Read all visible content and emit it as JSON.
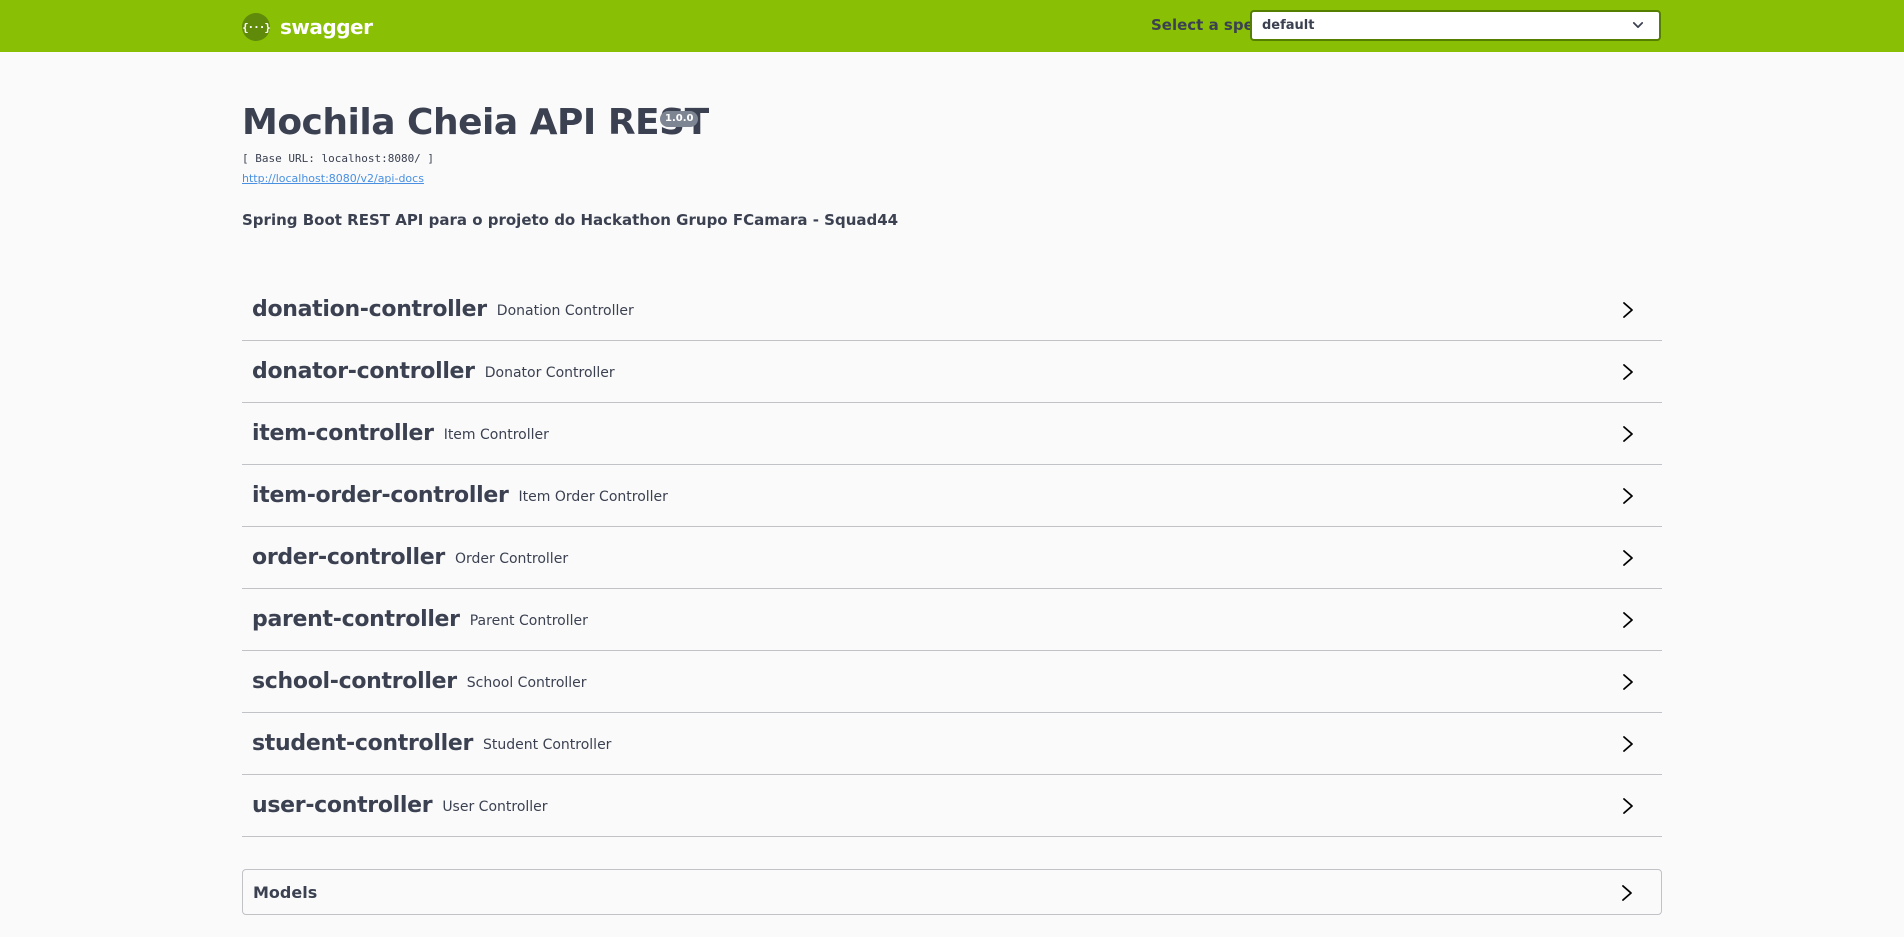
{
  "topbar": {
    "logo_glyph": "{···}",
    "logo_text": "swagger",
    "spec_label": "Select a spec",
    "spec_selected": "default",
    "logo_color": "#89bf04",
    "select_border_color": "#547f00"
  },
  "info": {
    "title": "Mochila Cheia API REST",
    "version": "1.0.0",
    "base_url": "[ Base URL: localhost:8080/ ]",
    "docs_link": "http://localhost:8080/v2/api-docs",
    "description": "Spring Boot REST API para o projeto do Hackathon Grupo FCamara - Squad44"
  },
  "tags": [
    {
      "name": "donation-controller",
      "description": "Donation Controller"
    },
    {
      "name": "donator-controller",
      "description": "Donator Controller"
    },
    {
      "name": "item-controller",
      "description": "Item Controller"
    },
    {
      "name": "item-order-controller",
      "description": "Item Order Controller"
    },
    {
      "name": "order-controller",
      "description": "Order Controller"
    },
    {
      "name": "parent-controller",
      "description": "Parent Controller"
    },
    {
      "name": "school-controller",
      "description": "School Controller"
    },
    {
      "name": "student-controller",
      "description": "Student Controller"
    },
    {
      "name": "user-controller",
      "description": "User Controller"
    }
  ],
  "models": {
    "title": "Models"
  },
  "icons": {
    "tag_arrow": "chevron-right-icon",
    "select_arrow": "chevron-down-icon",
    "logo": "swagger-logo-icon"
  }
}
